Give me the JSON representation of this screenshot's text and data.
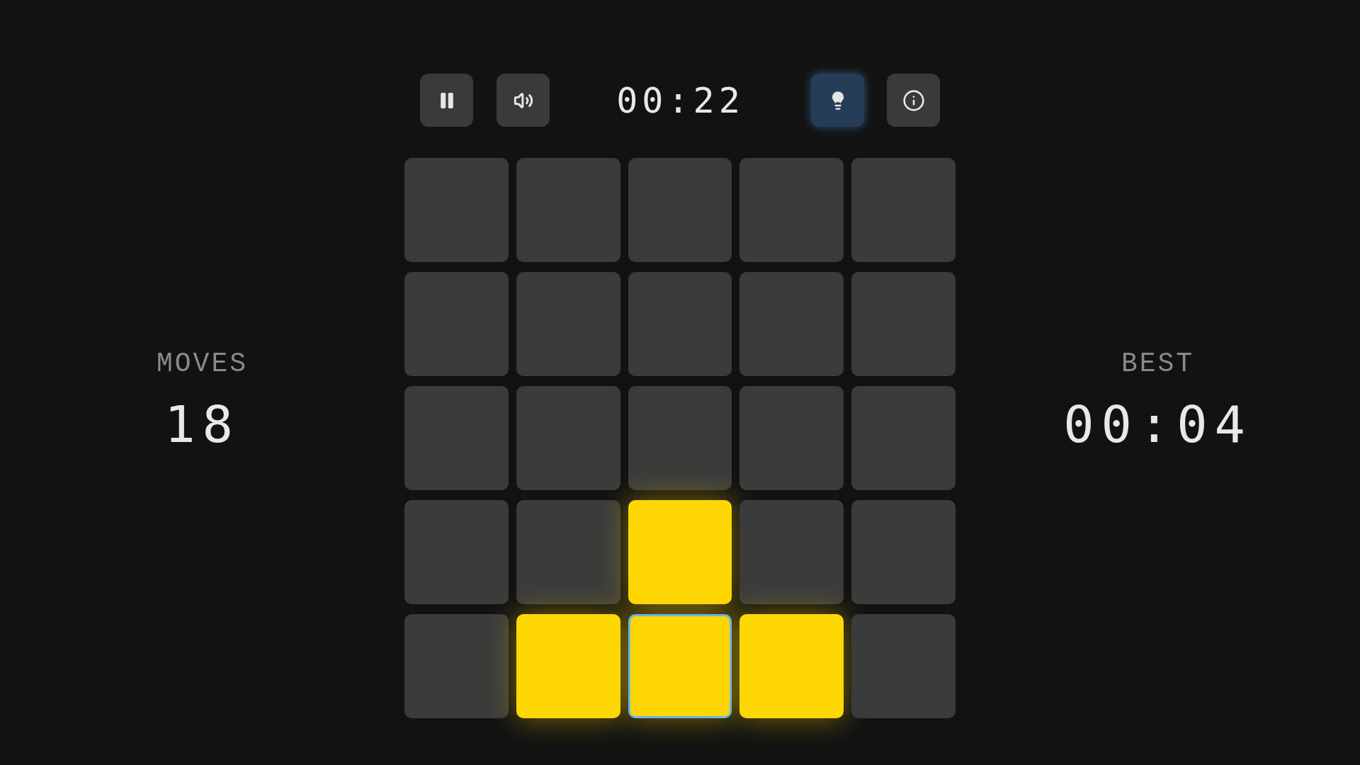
{
  "toolbar": {
    "buttons": [
      {
        "kind": "pause",
        "on": false
      },
      {
        "kind": "sound",
        "on": false
      }
    ],
    "timer": "00:22",
    "right_buttons": [
      {
        "kind": "hint",
        "on": true
      },
      {
        "kind": "info",
        "on": false
      }
    ]
  },
  "moves": {
    "label": "MOVES",
    "value": "18"
  },
  "best": {
    "label": "BEST",
    "value": "00:04"
  },
  "grid": {
    "rows": [
      [
        {
          "on": false,
          "selected": false
        },
        {
          "on": false,
          "selected": false
        },
        {
          "on": false,
          "selected": false
        },
        {
          "on": false,
          "selected": false
        },
        {
          "on": false,
          "selected": false
        }
      ],
      [
        {
          "on": false,
          "selected": false
        },
        {
          "on": false,
          "selected": false
        },
        {
          "on": false,
          "selected": false
        },
        {
          "on": false,
          "selected": false
        },
        {
          "on": false,
          "selected": false
        }
      ],
      [
        {
          "on": false,
          "selected": false
        },
        {
          "on": false,
          "selected": false
        },
        {
          "on": false,
          "selected": false
        },
        {
          "on": false,
          "selected": false
        },
        {
          "on": false,
          "selected": false
        }
      ],
      [
        {
          "on": false,
          "selected": false
        },
        {
          "on": false,
          "selected": false
        },
        {
          "on": true,
          "selected": false
        },
        {
          "on": false,
          "selected": false
        },
        {
          "on": false,
          "selected": false
        }
      ],
      [
        {
          "on": false,
          "selected": false
        },
        {
          "on": true,
          "selected": false
        },
        {
          "on": true,
          "selected": true
        },
        {
          "on": true,
          "selected": false
        },
        {
          "on": false,
          "selected": false
        }
      ]
    ]
  }
}
